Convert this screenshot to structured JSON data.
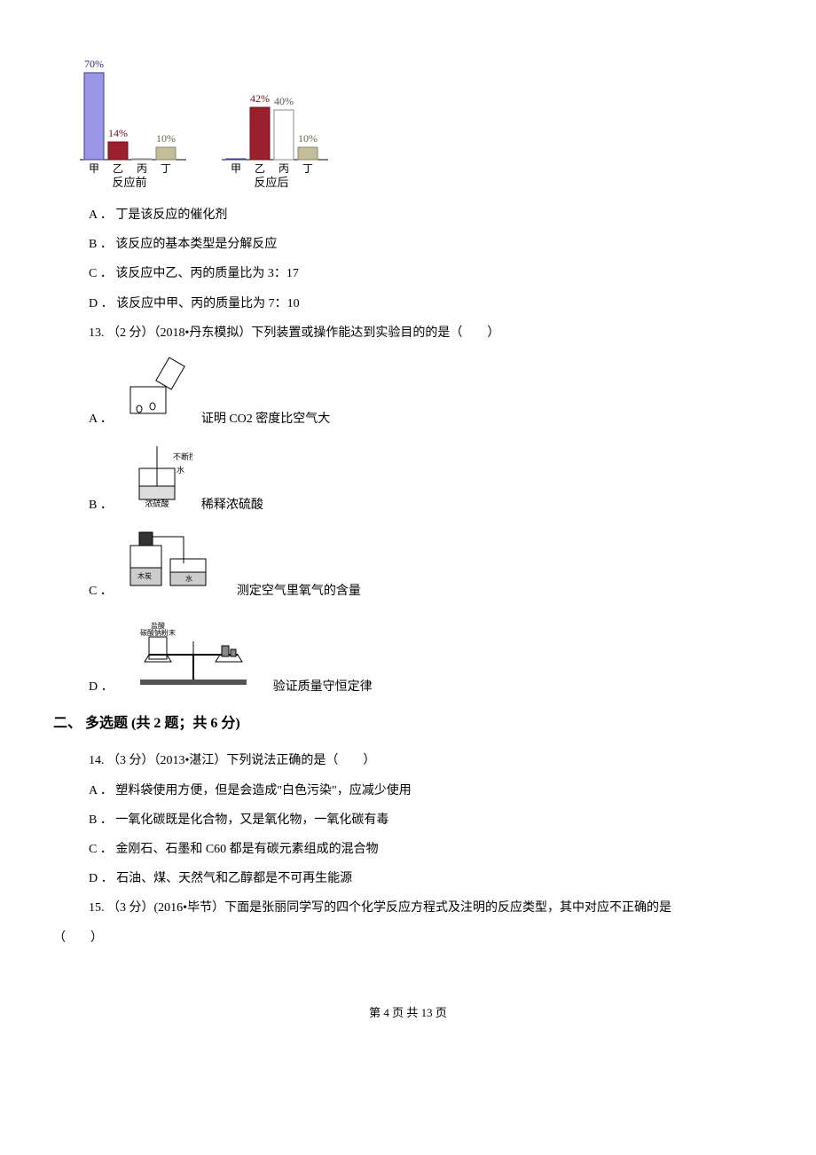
{
  "chart_data": [
    {
      "type": "bar",
      "title": "反应前",
      "categories": [
        "甲",
        "乙",
        "丙",
        "丁"
      ],
      "values": [
        70,
        14,
        null,
        10
      ],
      "data_labels": [
        "70%",
        "14%",
        "",
        "10%"
      ],
      "colors": [
        "#9b96e6",
        "#9c1f2e",
        "#ffffff",
        "#c3be99"
      ]
    },
    {
      "type": "bar",
      "title": "反应后",
      "categories": [
        "甲",
        "乙",
        "丙",
        "丁"
      ],
      "values": [
        null,
        null,
        42,
        40,
        10
      ],
      "prepared": {
        "categories": [
          "甲",
          "乙",
          "丙",
          "丁"
        ],
        "values": [
          0,
          42,
          40,
          10
        ],
        "data_labels": [
          "",
          "42%",
          "40%",
          "10%"
        ],
        "colors": [
          "#9b96e6",
          "#9c1f2e",
          "#ffffff",
          "#c3be99"
        ]
      }
    }
  ],
  "q12_options": {
    "a_prefix": "A ．",
    "a_text": "丁是该反应的催化剂",
    "b_prefix": "B ．",
    "b_text": "该反应的基本类型是分解反应",
    "c_prefix": "C ．",
    "c_text": "该反应中乙、丙的质量比为 3：17",
    "d_prefix": "D ．",
    "d_text": "该反应中甲、丙的质量比为 7：10"
  },
  "q13": {
    "stem": "13. （2 分）（2018•丹东模拟）下列装置或操作能达到实验目的的是（　　）",
    "a_prefix": "A ．",
    "a_text": "证明 CO2 密度比空气大",
    "b_prefix": "B ．",
    "b_text": "稀释浓硫酸",
    "c_prefix": "C ．",
    "c_text": "测定空气里氧气的含量",
    "d_prefix": "D ．",
    "d_text": "验证质量守恒定律"
  },
  "section2": {
    "header": "二、 多选题 (共 2 题；共 6 分)"
  },
  "q14": {
    "stem": "14. （3 分）（2013•湛江）下列说法正确的是（　　）",
    "a_prefix": "A ．",
    "a_text": "塑料袋使用方便，但是会造成\"白色污染\"，应减少使用",
    "b_prefix": "B ．",
    "b_text": "一氧化碳既是化合物，又是氧化物，一氧化碳有毒",
    "c_prefix": "C ．",
    "c_text": "金刚石、石墨和 C60 都是有碳元素组成的混合物",
    "d_prefix": "D ．",
    "d_text": "石油、煤、天然气和乙醇都是不可再生能源"
  },
  "q15": {
    "stem": "15. （3 分）(2016•毕节）下面是张丽同学写的四个化学反应方程式及注明的反应类型，其中对应不正确的是",
    "tail": "（　　）"
  },
  "footer": {
    "text": "第 4 页 共 13 页"
  }
}
